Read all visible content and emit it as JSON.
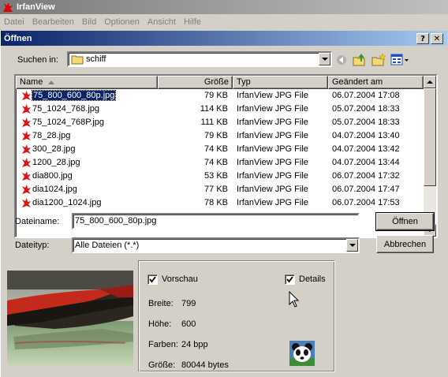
{
  "app": {
    "title": "IrfanView",
    "menu": [
      "Datei",
      "Bearbeiten",
      "Bild",
      "Optionen",
      "Ansicht",
      "Hilfe"
    ]
  },
  "dialog": {
    "title": "Öffnen",
    "help_btn": "?",
    "close_btn": "✕",
    "look_in_label": "Suchen in:",
    "look_in_value": "schiff"
  },
  "columns": {
    "name": "Name",
    "size": "Größe",
    "type": "Typ",
    "modified": "Geändert am"
  },
  "files": [
    {
      "name": "75_800_600_80p.jpg",
      "size": "79 KB",
      "type": "IrfanView JPG File",
      "modified": "06.07.2004 17:08",
      "selected": true
    },
    {
      "name": "75_1024_768.jpg",
      "size": "114 KB",
      "type": "IrfanView JPG File",
      "modified": "05.07.2004 18:33"
    },
    {
      "name": "75_1024_768P.jpg",
      "size": "111 KB",
      "type": "IrfanView JPG File",
      "modified": "05.07.2004 18:33"
    },
    {
      "name": "78_28.jpg",
      "size": "79 KB",
      "type": "IrfanView JPG File",
      "modified": "04.07.2004 13:40"
    },
    {
      "name": "300_28.jpg",
      "size": "74 KB",
      "type": "IrfanView JPG File",
      "modified": "04.07.2004 13:42"
    },
    {
      "name": "1200_28.jpg",
      "size": "74 KB",
      "type": "IrfanView JPG File",
      "modified": "04.07.2004 13:44"
    },
    {
      "name": "dia800.jpg",
      "size": "53 KB",
      "type": "IrfanView JPG File",
      "modified": "06.07.2004 17:32"
    },
    {
      "name": "dia1024.jpg",
      "size": "77 KB",
      "type": "IrfanView JPG File",
      "modified": "06.07.2004 17:47"
    },
    {
      "name": "dia1200_1024.jpg",
      "size": "78 KB",
      "type": "IrfanView JPG File",
      "modified": "06.07.2004 17:53"
    }
  ],
  "filename": {
    "label": "Dateiname:",
    "value": "75_800_600_80p.jpg"
  },
  "filetype": {
    "label": "Dateityp:",
    "value": "Alle Dateien (*.*)"
  },
  "buttons": {
    "open": "Öffnen",
    "cancel": "Abbrechen"
  },
  "preview": {
    "preview_label": "Vorschau",
    "preview_checked": true,
    "details_label": "Details",
    "details_checked": true,
    "width_label": "Breite:",
    "width_value": "799",
    "height_label": "Höhe:",
    "height_value": "600",
    "colors_label": "Farben:",
    "colors_value": "24 bpp",
    "size_label": "Größe:",
    "size_value": "80044 bytes"
  },
  "icons": {
    "app": "irfanview-cat-icon",
    "folder": "folder-icon",
    "back": "back-arrow-icon",
    "up": "up-folder-icon",
    "new_folder": "new-folder-icon",
    "view_menu": "view-menu-icon",
    "file": "irfanview-file-icon",
    "panda": "panda-icon"
  }
}
